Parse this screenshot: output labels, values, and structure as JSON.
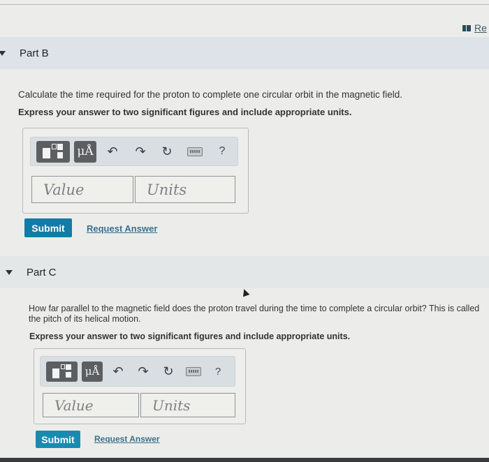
{
  "header": {
    "review_link_label": "Re",
    "review_icon": "book-icon"
  },
  "parts": [
    {
      "id": "B",
      "title": "Part B",
      "expanded": true,
      "question": "Calculate the time required for the proton to complete one circular orbit in the magnetic field.",
      "instruction": "Express your answer to two significant figures and include appropriate units.",
      "toolbar": {
        "templates_icon": "fraction-template-icon",
        "units_label": "μÅ",
        "undo_icon": "undo-icon",
        "redo_icon": "redo-icon",
        "reset_icon": "reset-icon",
        "keyboard_icon": "keyboard-icon",
        "help_label": "?"
      },
      "value_placeholder": "Value",
      "units_placeholder": "Units",
      "value": "",
      "units": "",
      "submit_label": "Submit",
      "request_answer_label": "Request Answer"
    },
    {
      "id": "C",
      "title": "Part C",
      "expanded": true,
      "question_line1": "How far parallel to the magnetic field does the proton travel during the time to complete a circular orbit? This is called",
      "question_line2": "the pitch of its helical motion.",
      "instruction": "Express your answer to two significant figures and include appropriate units.",
      "toolbar": {
        "templates_icon": "fraction-template-icon",
        "units_label": "μÅ",
        "undo_icon": "undo-icon",
        "redo_icon": "redo-icon",
        "reset_icon": "reset-icon",
        "keyboard_icon": "keyboard-icon",
        "help_label": "?"
      },
      "value_placeholder": "Value",
      "units_placeholder": "Units",
      "value": "",
      "units": "",
      "submit_label": "Submit",
      "request_answer_label": "Request Answer"
    }
  ],
  "colors": {
    "submit_bg": "#127ba6",
    "link": "#3a6f8f",
    "part_header_bg": "#dde3e8"
  }
}
